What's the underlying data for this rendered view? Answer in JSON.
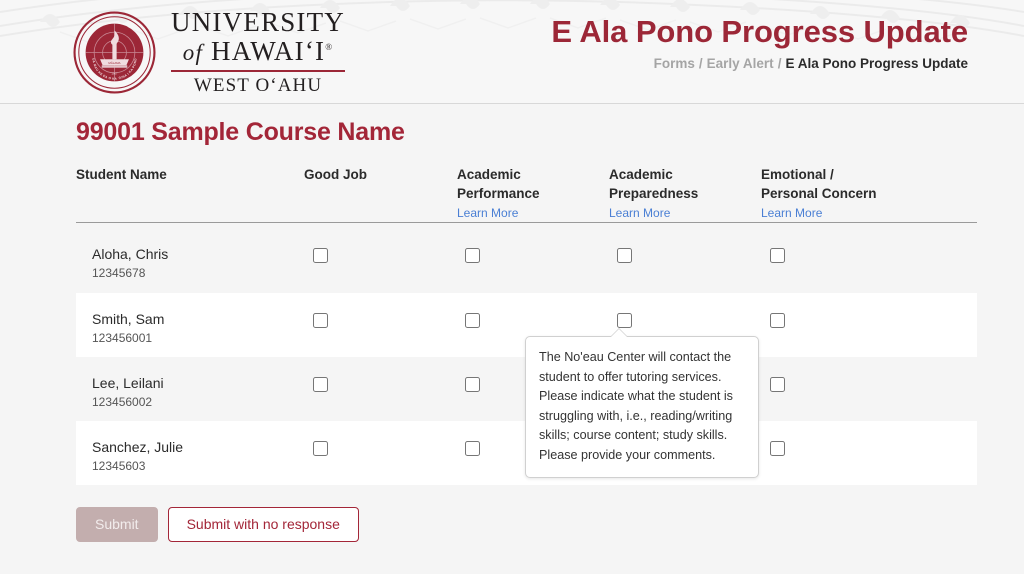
{
  "header": {
    "logo": {
      "seal_alt": "university-of-hawaii-seal",
      "line1": "UNIVERSITY",
      "line2_italic": "of",
      "line2_rest": "HAWAI‘I",
      "line3": "WEST O‘AHU"
    },
    "title": "E Ala Pono Progress Update",
    "breadcrumb": {
      "item1": "Forms",
      "sep1": "/",
      "item2": "Early Alert",
      "sep2": "/",
      "current": "E Ala Pono Progress Update"
    }
  },
  "main": {
    "course_title": "99001 Sample Course Name",
    "columns": {
      "student_name": "Student Name",
      "good_job": "Good Job",
      "academic_performance": "Academic Performance",
      "academic_preparedness": "Academic Preparedness",
      "emotional_personal_concern": "Emotional /\nPersonal Concern",
      "learn_more": "Learn More"
    },
    "rows": [
      {
        "name": "Aloha, Chris",
        "id": "12345678"
      },
      {
        "name": "Smith, Sam",
        "id": "123456001"
      },
      {
        "name": "Lee, Leilani",
        "id": "123456002"
      },
      {
        "name": "Sanchez, Julie",
        "id": "12345603"
      }
    ],
    "tooltip": {
      "text": "The No'eau Center will contact the student to offer tutoring services. Please indicate what the student is struggling with, i.e., reading/writing skills; course content; study skills. Please provide your comments."
    },
    "buttons": {
      "submit": "Submit",
      "submit_no_response": "Submit with no response"
    }
  },
  "colors": {
    "brand_red": "#a32638",
    "logo_red": "#9c2737",
    "link_blue": "#4a7fd4",
    "page_bg": "#f5f5f5",
    "row_alt": "#ffffff",
    "submit_disabled": "#c3aeae"
  }
}
